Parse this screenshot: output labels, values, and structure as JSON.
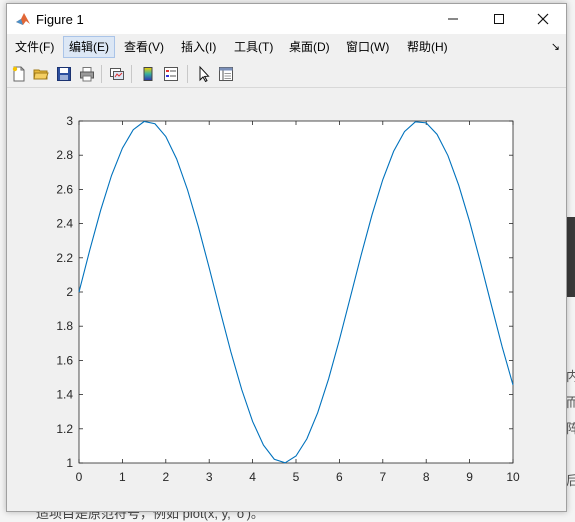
{
  "window": {
    "title": "Figure 1",
    "controls": [
      "minimize",
      "maximize",
      "close"
    ]
  },
  "menubar": {
    "items": [
      {
        "label": "文件(F)"
      },
      {
        "label": "编辑(E)"
      },
      {
        "label": "查看(V)"
      },
      {
        "label": "插入(I)"
      },
      {
        "label": "工具(T)"
      },
      {
        "label": "桌面(D)"
      },
      {
        "label": "窗口(W)"
      },
      {
        "label": "帮助(H)"
      }
    ],
    "active_index": 1
  },
  "toolbar": {
    "buttons": [
      "new-figure-icon",
      "open-file-icon",
      "save-icon",
      "print-icon",
      "link-plot-icon",
      "insert-colorbar-icon",
      "insert-legend-icon",
      "pointer-icon",
      "property-inspector-icon"
    ]
  },
  "background_text": {
    "right_fragments": [
      "内",
      "而",
      "阵",
      "后"
    ],
    "bottom": "适项目是原范符号，例如 plot(x, y, 'o')。"
  },
  "chart_data": {
    "type": "line",
    "title": "",
    "xlabel": "",
    "ylabel": "",
    "xlim": [
      0,
      10
    ],
    "ylim": [
      1,
      3
    ],
    "xticks": [
      "0",
      "1",
      "2",
      "3",
      "4",
      "5",
      "6",
      "7",
      "8",
      "9",
      "10"
    ],
    "yticks": [
      "1",
      "1.2",
      "1.4",
      "1.6",
      "1.8",
      "2",
      "2.2",
      "2.4",
      "2.6",
      "2.8",
      "3"
    ],
    "grid": false,
    "line_color": "#0072bd",
    "series": [
      {
        "function": "y = 2 + sin(x)",
        "x": [
          0,
          0.25,
          0.5,
          0.75,
          1,
          1.25,
          1.5,
          1.75,
          2,
          2.25,
          2.5,
          2.75,
          3,
          3.25,
          3.5,
          3.75,
          4,
          4.25,
          4.5,
          4.75,
          5,
          5.25,
          5.5,
          5.75,
          6,
          6.25,
          6.5,
          6.75,
          7,
          7.25,
          7.5,
          7.75,
          8,
          8.25,
          8.5,
          8.75,
          9,
          9.25,
          9.5,
          9.75,
          10
        ],
        "y": [
          2.0,
          2.247,
          2.479,
          2.682,
          2.841,
          2.949,
          2.997,
          2.984,
          2.909,
          2.778,
          2.598,
          2.382,
          2.141,
          1.892,
          1.649,
          1.429,
          1.243,
          1.105,
          1.022,
          1.001,
          1.041,
          1.141,
          1.294,
          1.491,
          1.721,
          1.967,
          2.215,
          2.45,
          2.657,
          2.823,
          2.938,
          2.995,
          2.989,
          2.922,
          2.798,
          2.624,
          2.412,
          2.174,
          1.925,
          1.68,
          1.456
        ]
      }
    ]
  }
}
